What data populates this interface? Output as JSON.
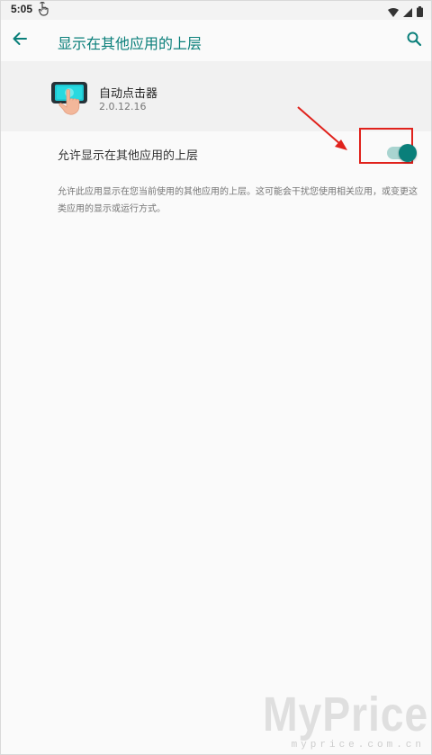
{
  "status_bar": {
    "time": "5:05",
    "icons": [
      "hand-pointer-icon",
      "wifi-icon",
      "signal-icon",
      "battery-icon"
    ]
  },
  "app_bar": {
    "title": "显示在其他应用的上层",
    "back_icon": "arrow-back-icon",
    "search_icon": "search-icon",
    "accent_color": "#0a7f7a"
  },
  "app_info": {
    "name": "自动点击器",
    "version": "2.0.12.16",
    "icon": "auto-clicker-app-icon"
  },
  "permission": {
    "label": "允许显示在其他应用的上层",
    "enabled": true,
    "description": "允许此应用显示在您当前使用的其他应用的上层。这可能会干扰您使用相关应用，或变更这类应用的显示或运行方式。"
  },
  "annotation": {
    "highlight_color": "#e0221c"
  },
  "watermark": {
    "text": "MyPrice",
    "subtext": "myprice.com.cn"
  }
}
